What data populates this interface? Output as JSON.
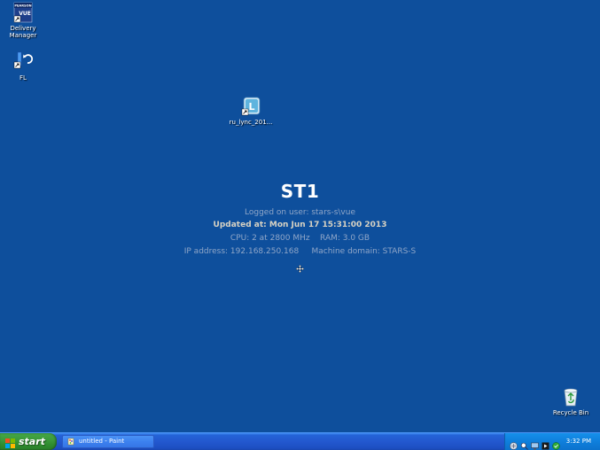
{
  "desktop": {
    "icons": [
      {
        "label": "Delivery Manager",
        "icon": "pearson-vue-icon"
      },
      {
        "label": "FL",
        "icon": "fl-shortcut-icon"
      },
      {
        "label": "ru_lync_201...",
        "icon": "lync-installer-icon"
      },
      {
        "label": "Recycle Bin",
        "icon": "recycle-bin-icon"
      }
    ],
    "pearson_badge": "PEARSON",
    "vue_badge": "VUE"
  },
  "sysinfo": {
    "hostname": "ST1",
    "logged_on": "Logged on user: stars-s\\vue",
    "updated": "Updated at: Mon Jun 17 15:31:00 2013",
    "hardware": "CPU: 2 at 2800 MHz    RAM: 3.0 GB",
    "network": "IP address: 192.168.250.168     Machine domain: STARS-S"
  },
  "taskbar": {
    "start_label": "start",
    "tasks": [
      {
        "label": "untitled - Paint",
        "icon": "paint-icon"
      }
    ],
    "clock": "3:32 PM"
  },
  "colors": {
    "desktop": "#0e4f9c",
    "taskbar": "#2358cf",
    "start": "#3c9a3c",
    "tray": "#0f7fdc"
  }
}
